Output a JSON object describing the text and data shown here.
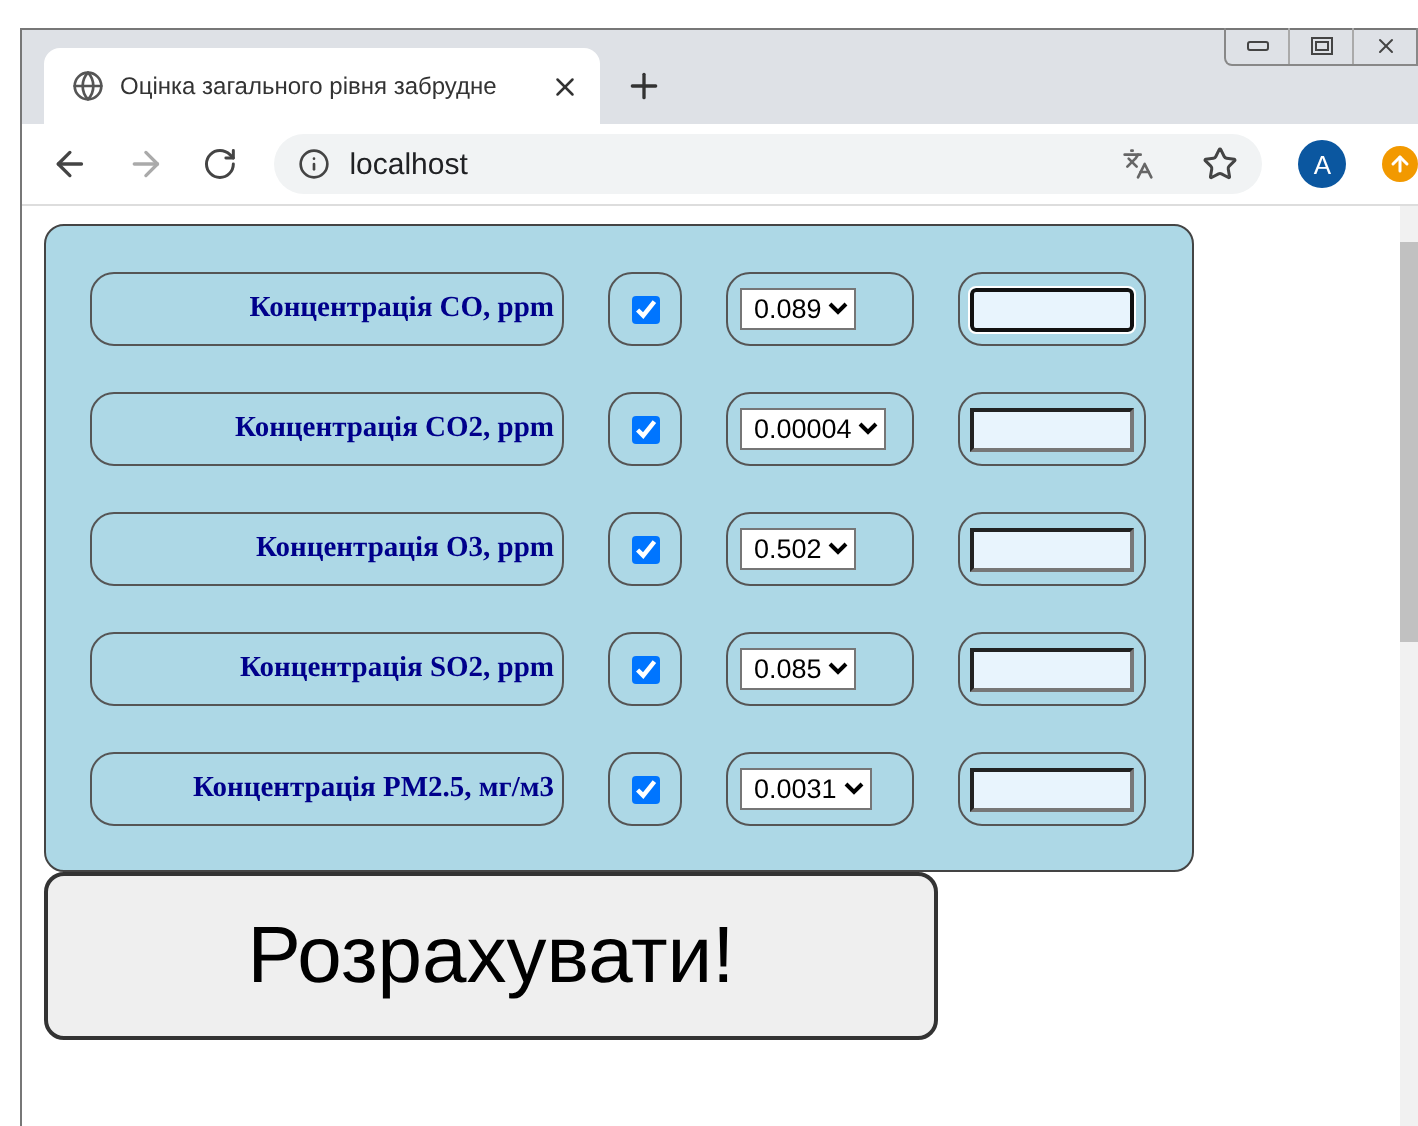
{
  "browser": {
    "tab_title": "Оцінка загального рівня забрудне",
    "address": "localhost",
    "avatar": "A"
  },
  "form": {
    "rows": [
      {
        "label": "Концентрація CO, ppm",
        "checked": true,
        "value": "0.089",
        "focused": true
      },
      {
        "label": "Концентрація CO2, ppm",
        "checked": true,
        "value": "0.00004",
        "focused": false
      },
      {
        "label": "Концентрація O3, ppm",
        "checked": true,
        "value": "0.502",
        "focused": false
      },
      {
        "label": "Концентрація SO2, ppm",
        "checked": true,
        "value": "0.085",
        "focused": false
      },
      {
        "label": "Концентрація PM2.5, мг/м3",
        "checked": true,
        "value": "0.0031",
        "focused": false
      }
    ],
    "button": "Розрахувати!"
  }
}
